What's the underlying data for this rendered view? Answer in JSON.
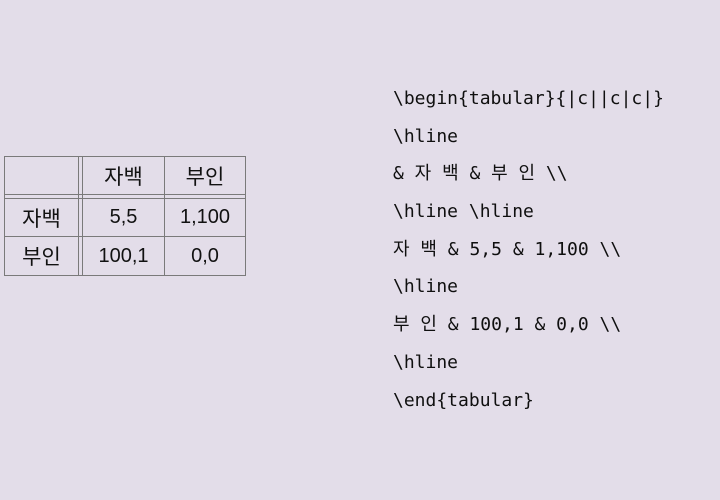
{
  "table": {
    "header": [
      "",
      "자백",
      "부인"
    ],
    "rows": [
      {
        "label": "자백",
        "cells": [
          "5,5",
          "1,100"
        ]
      },
      {
        "label": "부인",
        "cells": [
          "100,1",
          "0,0"
        ]
      }
    ]
  },
  "source": {
    "lines": [
      "\\begin{tabular}{|c||c|c|}",
      "\\hline",
      "& 자 백 & 부 인 \\\\",
      "\\hline \\hline",
      "자 백 & 5,5 & 1,100 \\\\",
      "\\hline",
      "부 인 & 100,1 & 0,0 \\\\",
      "\\hline",
      "\\end{tabular}"
    ]
  }
}
